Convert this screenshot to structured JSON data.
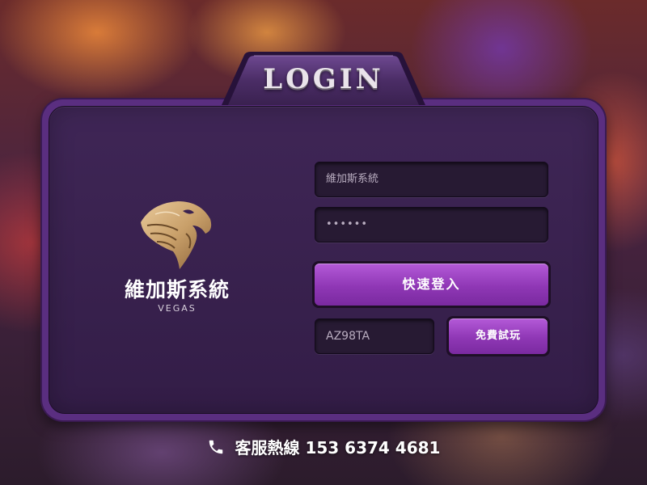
{
  "header": {
    "title": "LOGIN"
  },
  "brand": {
    "logo_icon": "eagle-head-icon",
    "name": "維加斯系統",
    "subtitle": "VEGAS"
  },
  "form": {
    "account_value": "維加斯系統",
    "password_value": "••••••",
    "login_button": "快速登入",
    "captcha_value": "AZ98TA",
    "free_trial_button": "免費試玩"
  },
  "footer": {
    "phone_icon": "phone-icon",
    "hotline_label": "客服熱線",
    "hotline_number": "153 6374 4681"
  },
  "colors": {
    "accent": "#9b44c4",
    "panel_border": "#5a2e80",
    "panel_bg": "#3a2250",
    "input_bg": "#271a33",
    "logo_gold": "#c9a06a"
  }
}
